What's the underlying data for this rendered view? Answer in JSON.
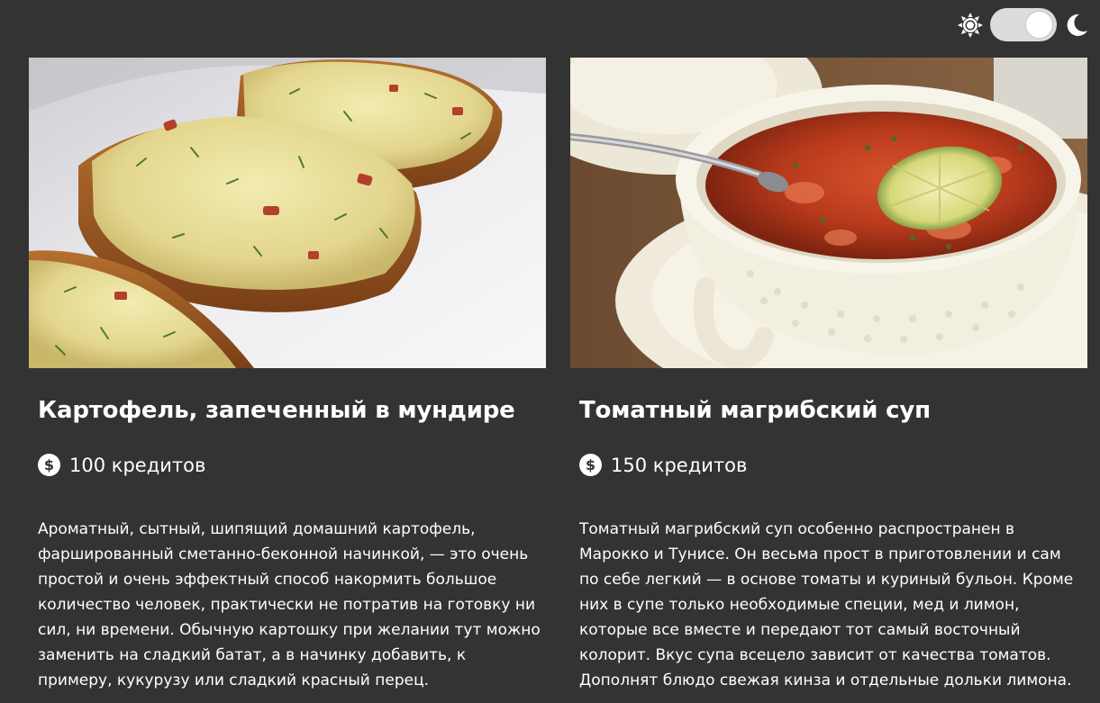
{
  "theme_toggle": {
    "sun_icon": "sun-icon",
    "moon_icon": "moon-icon",
    "state": "light"
  },
  "colors": {
    "background": "#333333",
    "text": "#ffffff",
    "switch_track": "#dcdcdc"
  },
  "cards": [
    {
      "title": "Картофель, запеченный в мундире",
      "price_icon": "dollar-circle-icon",
      "price": "100 кредитов",
      "description": "Ароматный, сытный, шипящий домашний картофель, фаршированный сметанно-беконной начинкой, — это очень простой и очень эффектный способ накормить большое количество человек, практически не потратив на готовку ни сил, ни времени. Обычную картошку при желании тут можно заменить на сладкий батат, а в начинку добавить, к примеру, кукурузу или сладкий красный перец."
    },
    {
      "title": "Томатный магрибский суп",
      "price_icon": "dollar-circle-icon",
      "price": "150 кредитов",
      "description": "Томатный магрибский суп особенно распространен в Марокко и Тунисе. Он весьма прост в приготовлении и сам по себе легкий — в основе томаты и куриный бульон. Кроме них в супе только необходимые специи, мед и лимон, которые все вместе и передают тот самый восточный колорит. Вкус супа всецело зависит от качества томатов. Дополнят блюдо свежая кинза и отдельные дольки лимона."
    }
  ]
}
